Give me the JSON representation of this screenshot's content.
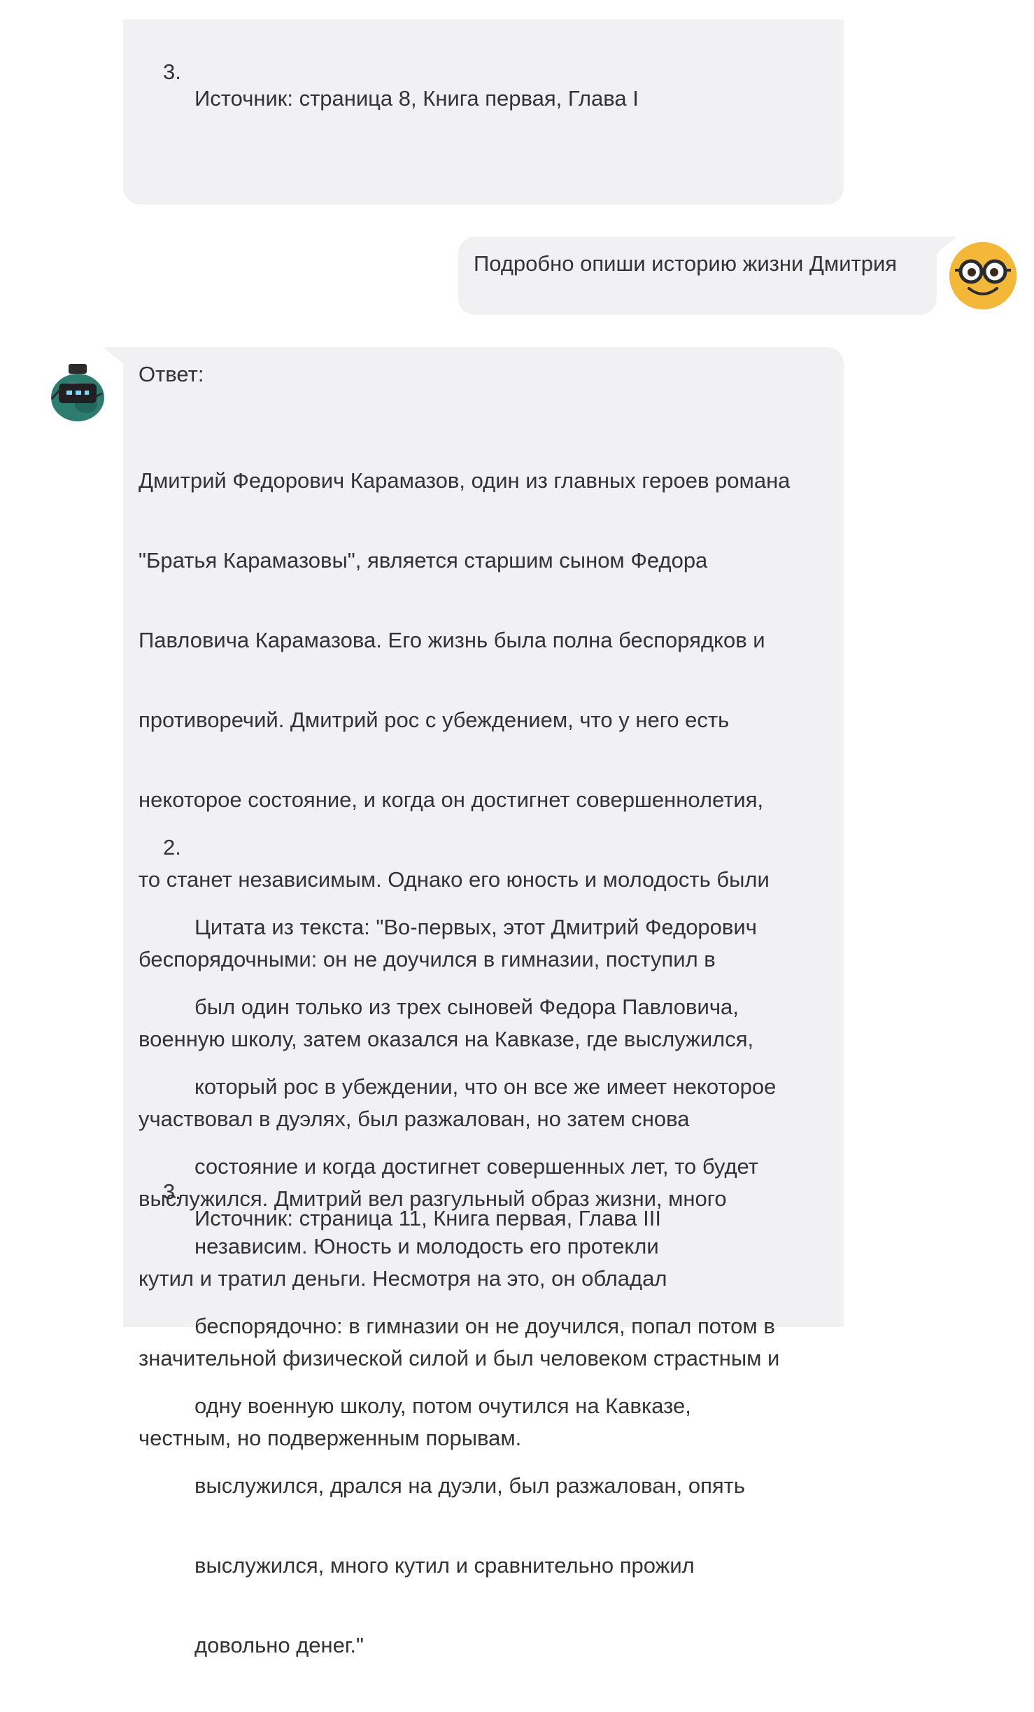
{
  "messages": {
    "prev_bot": {
      "item3_number": "3.",
      "item3_text": "Источник: страница 8, Книга первая, Глава I"
    },
    "user": {
      "text": "Подробно опиши историю жизни Дмитрия",
      "avatar_icon": "nerd-face-icon"
    },
    "bot": {
      "avatar_icon": "robot-icon",
      "heading": "Ответ:",
      "paragraph_lines": [
        "Дмитрий Федорович Карамазов, один из главных героев романа",
        "\"Братья Карамазовы\", является старшим сыном Федора",
        "Павловича Карамазова. Его жизнь была полна беспорядков и",
        "противоречий. Дмитрий рос с убеждением, что у него есть",
        "некоторое состояние, и когда он достигнет совершеннолетия,",
        "то станет независимым. Однако его юность и молодость были",
        "беспорядочными: он не доучился в гимназии, поступил в",
        "военную школу, затем оказался на Кавказе, где выслужился,",
        "участвовал в дуэлях, был разжалован, но затем снова",
        "выслужился. Дмитрий вел разгульный образ жизни, много",
        "кутил и тратил деньги. Несмотря на это, он обладал",
        "значительной физической силой и был человеком страстным и",
        "честным, но подверженным порывам."
      ],
      "item2_number": "2.",
      "item2_lines": [
        "Цитата из текста: \"Во-первых, этот Дмитрий Федорович",
        "был один только из трех сыновей Федора Павловича,",
        "который рос в убеждении, что он все же имеет некоторое",
        "состояние и когда достигнет совершенных лет, то будет",
        "независим. Юность и молодость его протекли",
        "беспорядочно: в гимназии он не доучился, попал потом в",
        "одну военную школу, потом очутился на Кавказе,",
        "выслужился, дрался на дуэли, был разжалован, опять",
        "выслужился, много кутил и сравнительно прожил",
        "довольно денег.\""
      ],
      "item3_number": "3.",
      "item3_text": "Источник: страница 11, Книга первая, Глава III"
    }
  },
  "colors": {
    "bubble": "#f1f1f4",
    "text": "#333336",
    "user_avatar": "#f3b73a",
    "bot_avatar": "#2e7c6f"
  }
}
